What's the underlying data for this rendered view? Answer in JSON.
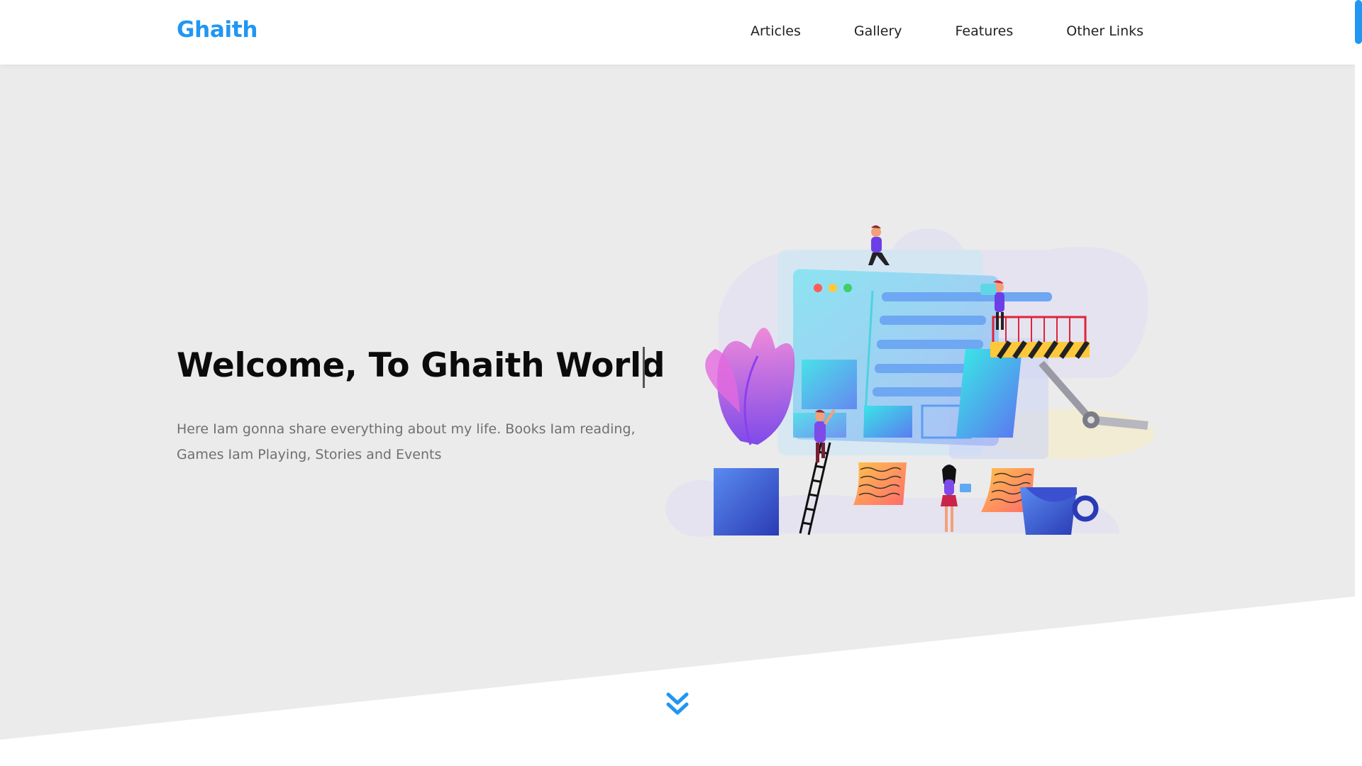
{
  "header": {
    "logo": "Ghaith",
    "nav": [
      {
        "label": "Articles"
      },
      {
        "label": "Gallery"
      },
      {
        "label": "Features"
      },
      {
        "label": "Other Links"
      }
    ]
  },
  "hero": {
    "title": "Welcome, To Ghaith World",
    "subtitle": "Here Iam gonna share everything about my life. Books Iam reading, Games Iam Playing, Stories and Events"
  },
  "icons": {
    "scroll_down": "double-chevron-down-icon"
  },
  "colors": {
    "accent": "#2196f3",
    "hero_bg": "#ebebeb",
    "title": "#0b0b0b",
    "subtitle": "#707070"
  }
}
